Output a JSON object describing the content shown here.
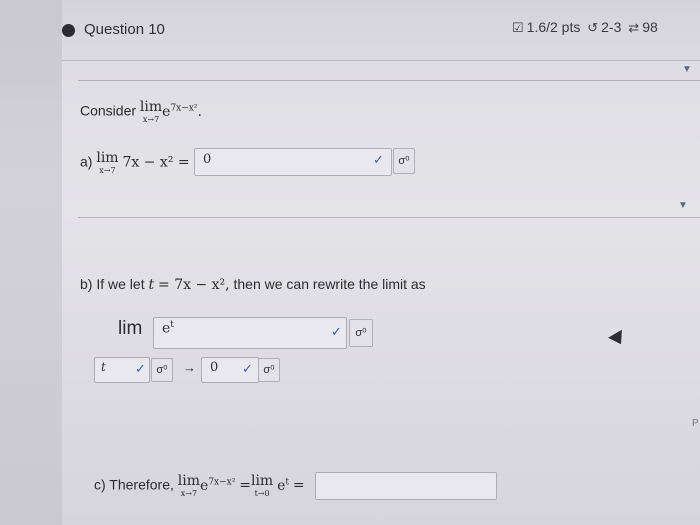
{
  "question": {
    "title": "Question 10",
    "score": "1.6/2 pts",
    "retry": "2-3",
    "sync": "98"
  },
  "intro": {
    "prefix": "Consider",
    "lim_word": "lim",
    "lim_sub": "x→7",
    "expr": "e",
    "exp": "7x−x²"
  },
  "part_a": {
    "label": "a)",
    "lim_word": "lim",
    "lim_sub": "x→7",
    "expr": "7x − x² =",
    "answer": "0"
  },
  "part_b": {
    "text_prefix": "b) If we let",
    "var": "t",
    "eq": "= 7x − x²,",
    "text_suffix": "then we can rewrite the limit as",
    "lim_word": "lim",
    "lim_body": "e",
    "lim_body_exp": "t",
    "var_field": "t",
    "arrow": "→",
    "limit_value": "0"
  },
  "part_c": {
    "text_prefix": "c) Therefore,",
    "lim_word": "lim",
    "lim_sub": "x→7",
    "expr": "e",
    "exp": "7x−x²",
    "eq": "=",
    "lim2_sub": "t→0",
    "expr2": "e",
    "exp2": "t",
    "eq2": "=",
    "answer": ""
  },
  "icons": {
    "check": "✓",
    "sigma": "σ⁰",
    "caret": "▼",
    "checkbox": "☑",
    "retry": "↺",
    "sync": "⇄"
  },
  "edge_char": "P"
}
